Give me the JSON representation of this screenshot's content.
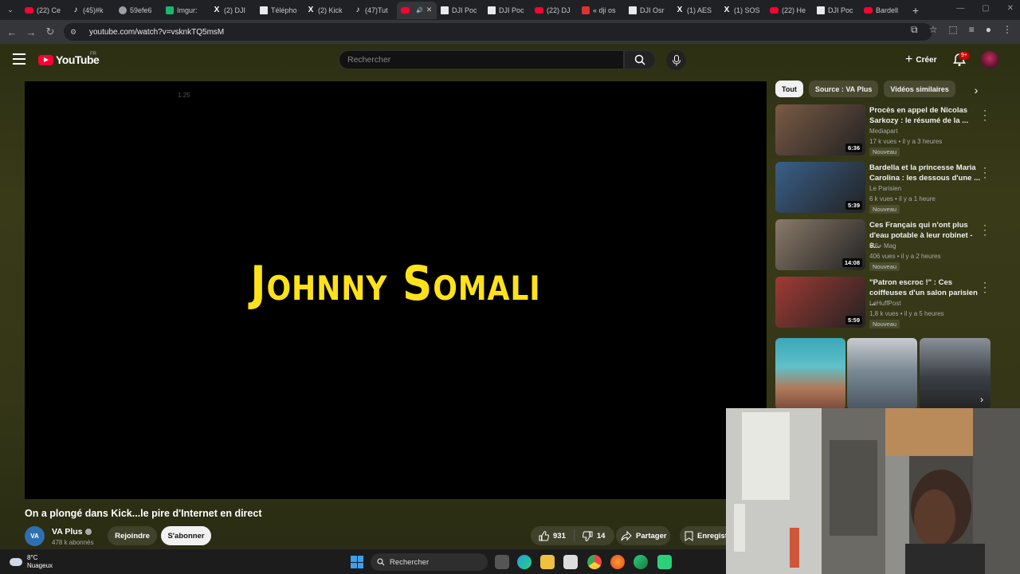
{
  "browser": {
    "tabs": [
      {
        "label": "(22) Ce",
        "favicon": "youtube-icon"
      },
      {
        "label": "(45)#k",
        "favicon": "tiktok-icon"
      },
      {
        "label": "59efe6",
        "favicon": "globe-icon"
      },
      {
        "label": "Imgur:",
        "favicon": "imgur-icon"
      },
      {
        "label": "(2) DJI",
        "favicon": "x-icon"
      },
      {
        "label": "Télépho",
        "favicon": "doc-icon"
      },
      {
        "label": "(2) Kick",
        "favicon": "x-icon"
      },
      {
        "label": "(47)Tut",
        "favicon": "tiktok-icon"
      },
      {
        "label": "",
        "favicon": "youtube-icon",
        "active": true
      },
      {
        "label": "DJI Poc",
        "favicon": "doc-icon"
      },
      {
        "label": "DJI Poc",
        "favicon": "doc-icon"
      },
      {
        "label": "(22) DJ",
        "favicon": "youtube-icon"
      },
      {
        "label": "« dji os",
        "favicon": "gdoc-icon"
      },
      {
        "label": "DJI Osr",
        "favicon": "doc-icon"
      },
      {
        "label": "(1) AES",
        "favicon": "x-icon"
      },
      {
        "label": "(1) SOS",
        "favicon": "x-icon"
      },
      {
        "label": "(22) He",
        "favicon": "youtube-icon"
      },
      {
        "label": "DJI Poc",
        "favicon": "doc-icon"
      },
      {
        "label": "Bardell",
        "favicon": "youtube-icon"
      }
    ],
    "url": "youtube.com/watch?v=vsknkTQ5msM"
  },
  "youtube": {
    "logo_text": "YouTube",
    "country": "FR",
    "search_placeholder": "Rechercher",
    "create_label": "Créer",
    "notif_count": "9+"
  },
  "player": {
    "overlay_text": "1.25",
    "title_card": "Johnny Somali"
  },
  "video": {
    "title": "On a plongé dans Kick...le pire d'Internet en direct",
    "channel": "VA Plus",
    "channel_avatar": "VA",
    "subscribers": "478 k abonnés",
    "join_label": "Rejoindre",
    "subscribe_label": "S'abonner",
    "likes": "931",
    "dislikes": "14",
    "share_label": "Partager",
    "save_label": "Enregist"
  },
  "chips": [
    "Tout",
    "Source : VA Plus",
    "Vidéos similaires"
  ],
  "recommendations": [
    {
      "title": "Procès en appel de Nicolas Sarkozy : le résumé de la ...",
      "channel": "Mediapart",
      "meta": "17 k vues • il y a 3 heures",
      "badge": "Nouveau",
      "duration": "6:36",
      "thumb_color": "#7a5a45"
    },
    {
      "title": "Bardella et la princesse Maria Carolina : les dessous d'une ...",
      "channel": "Le Parisien",
      "meta": "6 k vues • il y a 1 heure",
      "badge": "Nouveau",
      "duration": "5:39",
      "thumb_color": "#3a5f8a"
    },
    {
      "title": "Ces Français qui n'ont plus d'eau potable à leur robinet - 6...",
      "channel": "M6+ Mag",
      "meta": "406 vues • il y a 2 heures",
      "badge": "Nouveau",
      "duration": "14:08",
      "thumb_color": "#8a7a6a"
    },
    {
      "title": "\"Patron escroc !\" : Ces coiffeuses d'un salon parisien ...",
      "channel": "LeHuffPost",
      "meta": "1,8 k vues • il y a 5 heures",
      "badge": "Nouveau",
      "duration": "5:59",
      "thumb_color": "#a03a35"
    }
  ],
  "taskbar": {
    "temperature": "8°C",
    "weather": "Nuageux",
    "search_label": "Rechercher"
  }
}
